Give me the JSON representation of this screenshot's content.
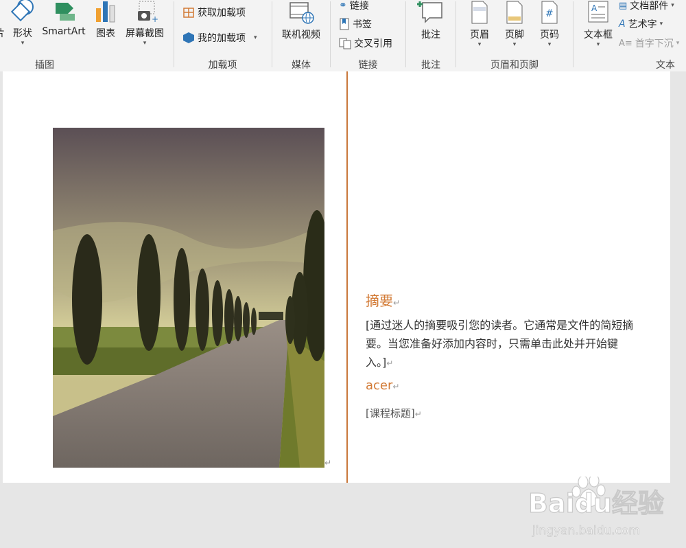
{
  "ribbon": {
    "illustrations": {
      "group_label": "插图",
      "cut_label": "片",
      "shapes": "形状",
      "smartart": "SmartArt",
      "chart": "图表",
      "screenshot": "屏幕截图"
    },
    "addins": {
      "group_label": "加载项",
      "get_addins": "获取加载项",
      "my_addins": "我的加载项"
    },
    "media": {
      "group_label": "媒体",
      "online_video": "联机视频"
    },
    "links": {
      "group_label": "链接",
      "link": "链接",
      "bookmark": "书签",
      "cross_ref": "交叉引用"
    },
    "comments": {
      "group_label": "批注",
      "comment": "批注"
    },
    "header_footer": {
      "group_label": "页眉和页脚",
      "header": "页眉",
      "footer": "页脚",
      "page_number": "页码"
    },
    "text": {
      "group_label": "文本",
      "text_box": "文本框",
      "quick_parts": "文档部件",
      "wordart": "艺术字",
      "drop_cap": "首字下沉"
    }
  },
  "document": {
    "abstract_heading": "摘要",
    "abstract_text": "[通过迷人的摘要吸引您的读者。它通常是文件的简短摘要。当您准备好添加内容时，只需单击此处并开始键入。]",
    "author": "acer",
    "course_title": "[课程标题]",
    "para_mark": "↵"
  },
  "watermark": {
    "brand": "Baidu经验",
    "url": "jingyan.baidu.com"
  },
  "colors": {
    "accent": "#d27a35",
    "ribbon_bg": "#f3f3f3",
    "page_bg": "#ffffff"
  }
}
